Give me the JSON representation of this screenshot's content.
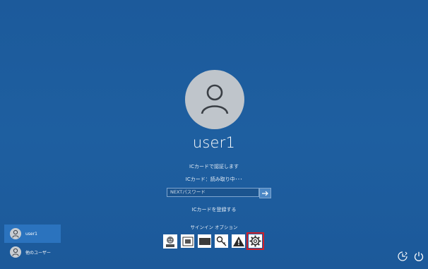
{
  "user": {
    "name": "user1"
  },
  "messages": {
    "ic_card_login": "ICカードで認証します",
    "ic_card_status": "ICカード：読み取り中･･･"
  },
  "password": {
    "placeholder": "NEXTパスワード"
  },
  "register_link": "ICカードを登録する",
  "signin_options_label": "サインイン オプション",
  "user_list": [
    {
      "label": "user1",
      "active": true
    },
    {
      "label": "他のユーザー",
      "active": false
    }
  ],
  "icons": {
    "face": "face-signin-icon",
    "card": "smart-card-icon",
    "black_card": "card-reader-icon",
    "key": "key-icon",
    "warning": "warning-icon",
    "gear": "settings-gear-icon",
    "ease_of_access": "ease-of-access-icon",
    "power": "power-icon"
  },
  "colors": {
    "background": "#1d5c9c",
    "accent": "#2b73be",
    "selection": "#d0202a"
  }
}
